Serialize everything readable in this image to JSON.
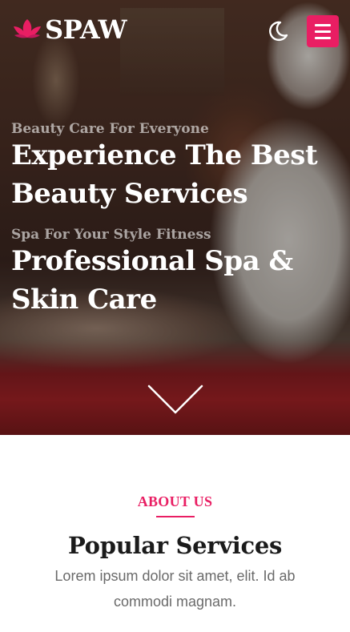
{
  "header": {
    "logo_text": "SPAW",
    "logo_icon": "lotus-icon",
    "theme_toggle_icon": "moon-icon",
    "menu_icon": "hamburger-icon",
    "accent_color": "#e91e63"
  },
  "hero": {
    "slides": [
      {
        "eyebrow": "Beauty Care For Everyone",
        "headline": "Experience The Best Beauty Services"
      },
      {
        "eyebrow": "Spa For Your Style Fitness",
        "headline": "Professional Spa & Skin Care"
      }
    ],
    "scroll_icon": "chevron-down-icon"
  },
  "about": {
    "eyebrow": "ABOUT US",
    "title": "Popular Services",
    "text": "Lorem ipsum dolor sit amet, elit. Id ab commodi magnam."
  }
}
